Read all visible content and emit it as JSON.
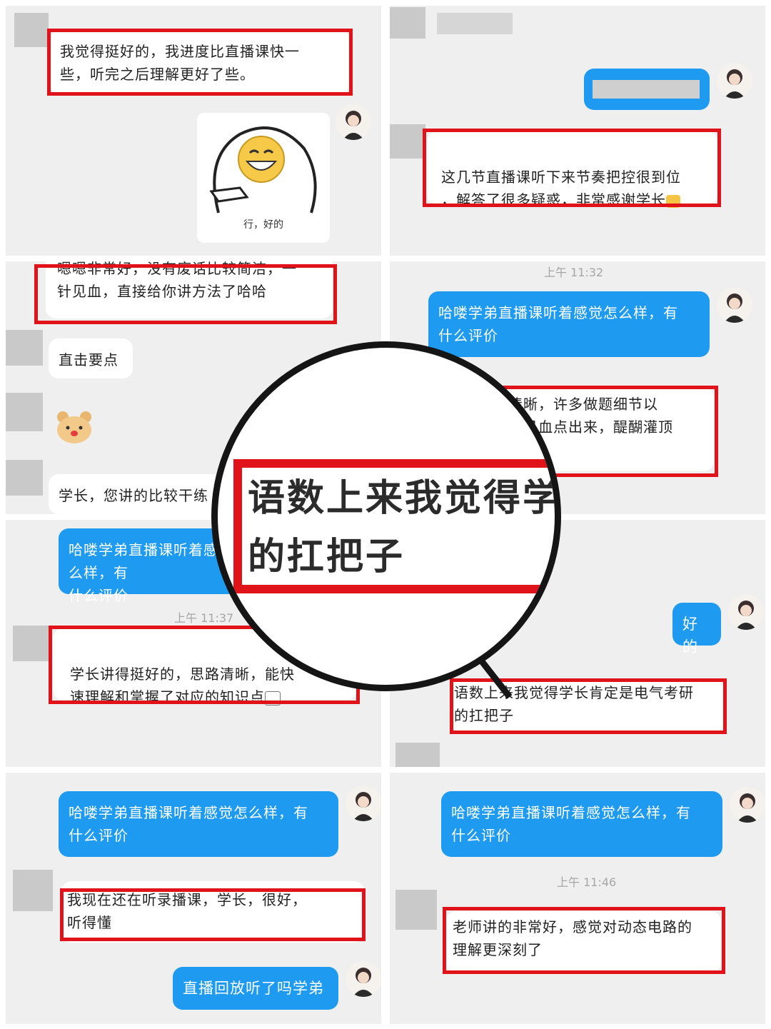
{
  "panels": {
    "p1": {
      "msg1": "我觉得挺好的，我进度比直播课快一\n些，听完之后理解更好了些。",
      "sticker_caption": "行，好的"
    },
    "p2": {
      "msg1": "这几节直播课听下来节奏把控很到位\n，解答了很多疑惑，非常感谢学长"
    },
    "p3": {
      "msg1": "嗯嗯非常好，没有废话比较简洁，一\n针见血，直接给你讲方法了哈哈",
      "msg2": "直击要点",
      "msg3": "学长，您讲的比较干练"
    },
    "p4": {
      "timestamp": "上午 11:32",
      "question": "哈喽学弟直播课听着感觉怎么样，有\n什么评价",
      "msg1": "思路清晰，许多做题细节以\n及一针见血点出来，醍醐灌顶"
    },
    "p5": {
      "question": "哈喽学弟直播课听着感觉怎么样，有\n什么评价",
      "timestamp": "上午 11:37",
      "msg1": "学长讲得挺好的，思路清晰，能快\n速理解和掌握了对应的知识点"
    },
    "p6": {
      "reply": "好的",
      "msg1": "语数上来我觉得学长肯定是电气考研\n的扛把子"
    },
    "p7": {
      "question": "哈喽学弟直播课听着感觉怎么样，有\n什么评价",
      "msg1": "我现在还在听录播课，学长，很好，\n听得懂",
      "reply": "直播回放听了吗学弟"
    },
    "p8": {
      "question": "哈喽学弟直播课听着感觉怎么样，有\n什么评价",
      "timestamp": "上午 11:46",
      "msg1": "老师讲的非常好，感觉对动态电路的\n理解更深刻了"
    }
  },
  "magnifier": {
    "line1": "语数上来我觉得学",
    "line2": "的扛把子"
  },
  "colors": {
    "highlight": "#e0121a",
    "blue_bubble": "#1e9bf0",
    "panel_bg": "#efefef"
  },
  "icons": [
    "avatar",
    "grin-sticker",
    "bear-sticker",
    "magnifier"
  ]
}
